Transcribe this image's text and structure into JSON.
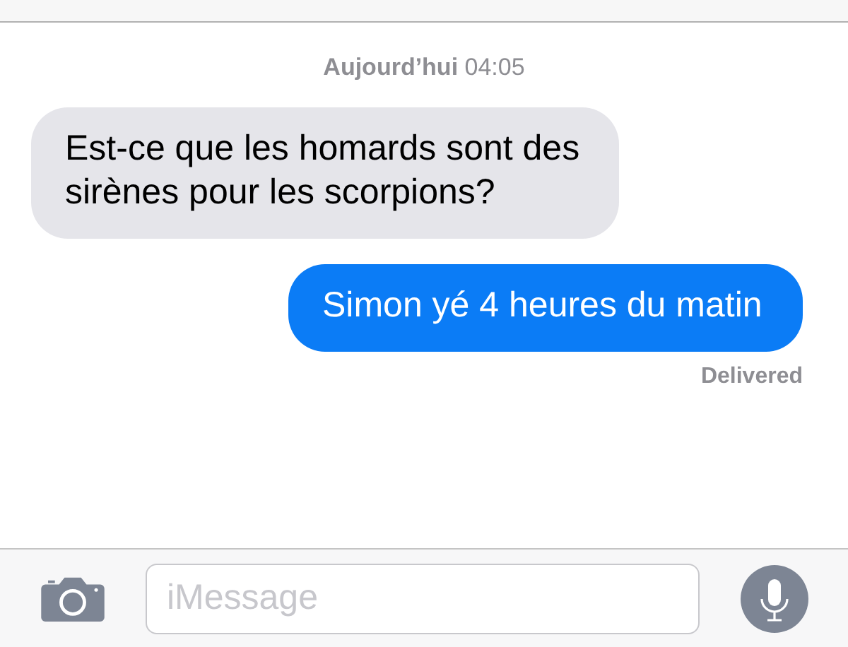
{
  "timestamp": "**Aujourd’hui** 04:05",
  "messages": [
    {
      "kind": "incoming",
      "text": "Est-ce que les homards sont des sirènes pour les scorpions?"
    },
    {
      "kind": "outgoing",
      "text": "Simon yé 4 heures du matin"
    }
  ],
  "delivery_status": "Delivered",
  "input": {
    "placeholder": "iMessage"
  }
}
